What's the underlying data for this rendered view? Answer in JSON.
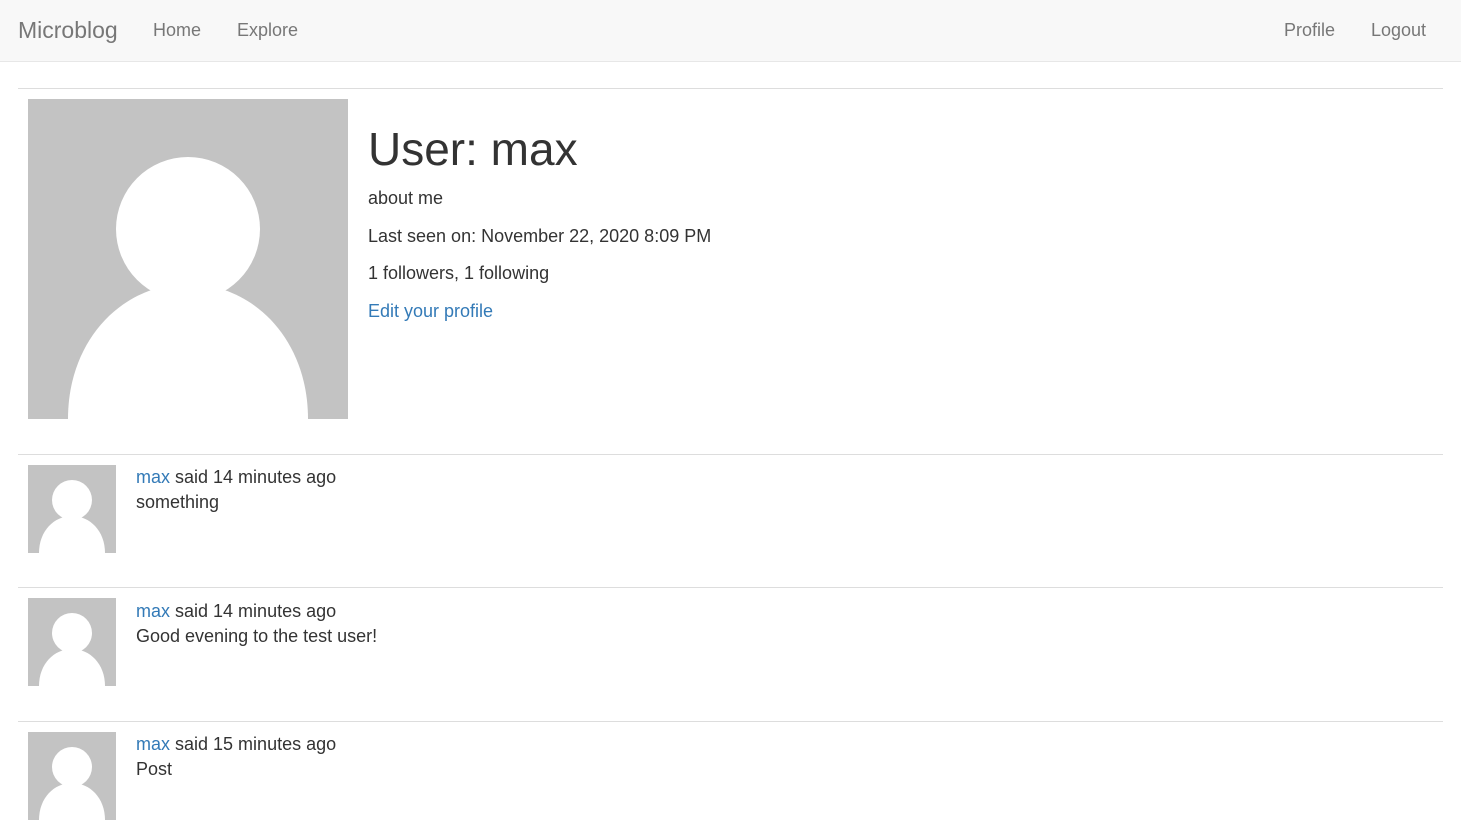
{
  "navbar": {
    "brand": "Microblog",
    "left_links": [
      "Home",
      "Explore"
    ],
    "right_links": [
      "Profile",
      "Logout"
    ]
  },
  "profile": {
    "title": "User: max",
    "about": "about me",
    "last_seen": "Last seen on: November 22, 2020 8:09 PM",
    "follow_counts": "1 followers, 1 following",
    "edit_link": "Edit your profile",
    "avatar_icon": "default-avatar-icon"
  },
  "posts": [
    {
      "author": "max",
      "said": " said 14 minutes ago",
      "body": "something"
    },
    {
      "author": "max",
      "said": " said 14 minutes ago",
      "body": "Good evening to the test user!"
    },
    {
      "author": "max",
      "said": " said 15 minutes ago",
      "body": "Post"
    }
  ],
  "colors": {
    "link": "#337ab7",
    "navbar_bg": "#f8f8f8",
    "avatar_bg": "#c3c3c3",
    "avatar_fg": "#ffffff"
  }
}
